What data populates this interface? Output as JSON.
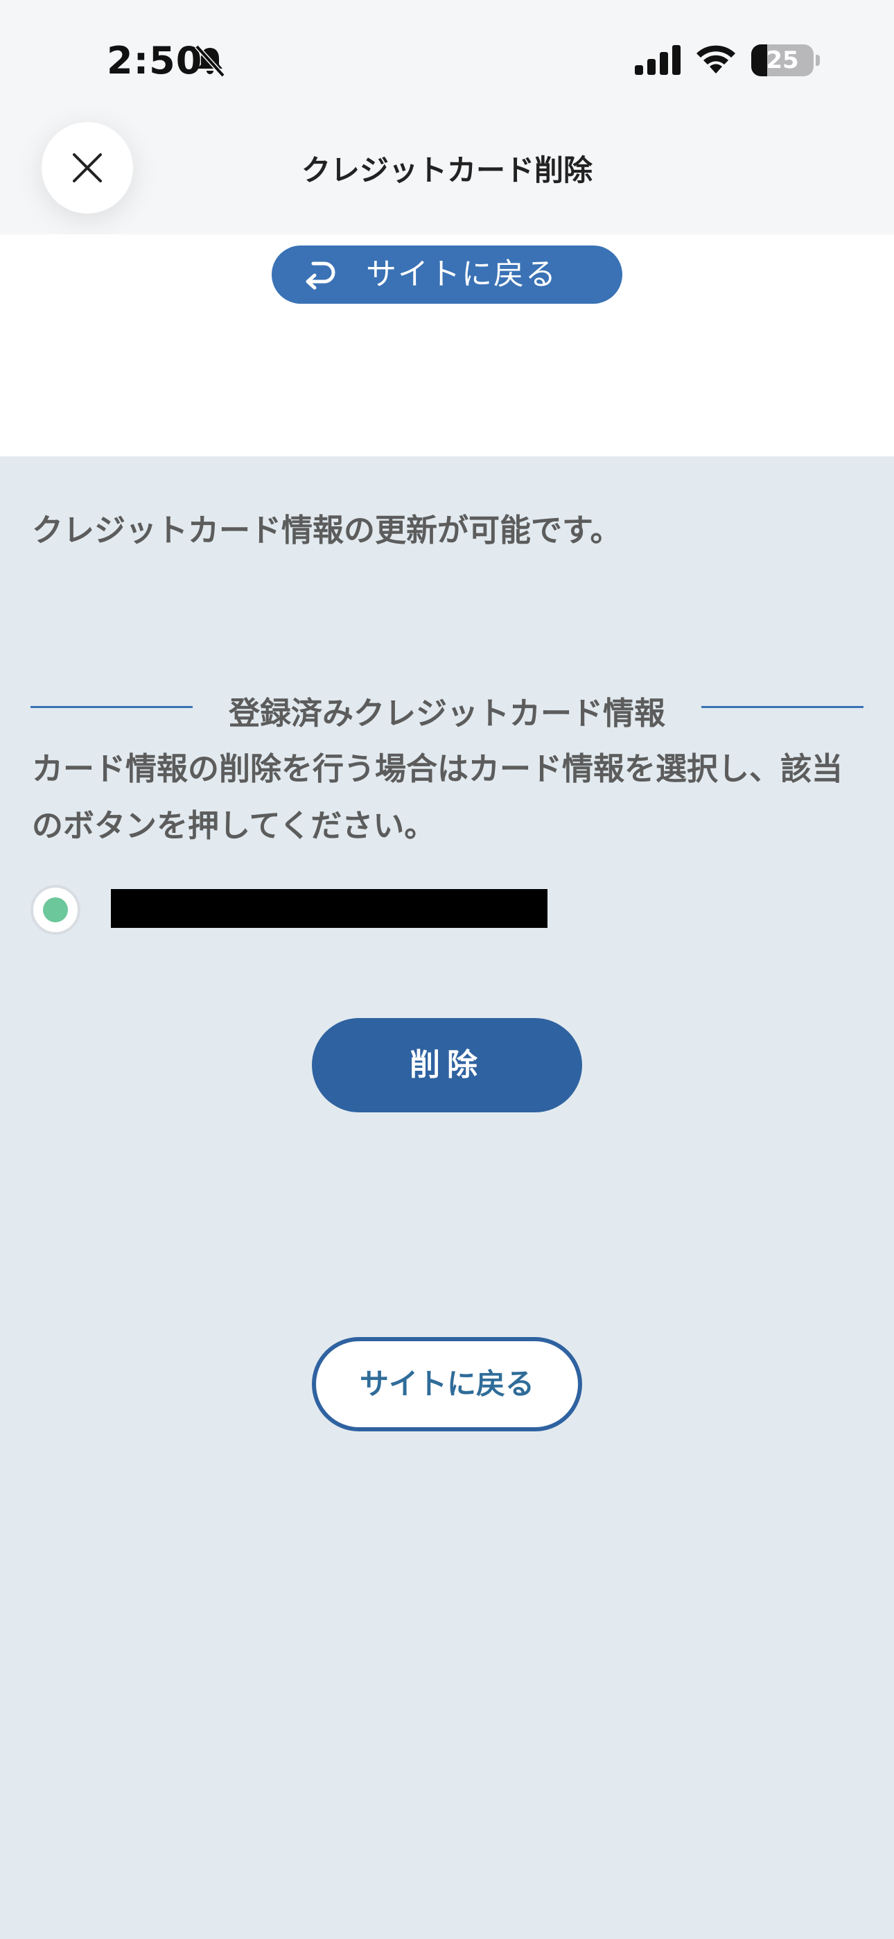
{
  "status_bar": {
    "time": "2:50",
    "battery_level": "25",
    "battery_fraction": 0.25,
    "icons": [
      "bell-slash-icon",
      "cellular-signal-icon",
      "wifi-icon",
      "battery-icon"
    ]
  },
  "nav": {
    "close_icon": "close-icon",
    "title": "クレジットカード削除"
  },
  "top_back_button": {
    "icon": "return-arrow-icon",
    "label": "サイトに戻る"
  },
  "main": {
    "info_text": "クレジットカード情報の更新が可能です。",
    "section_heading": "登録済みクレジットカード情報",
    "instructions": "カード情報の削除を行う場合はカード情報を選択し、該当のボタンを押してください。",
    "card": {
      "selected": true,
      "number_redacted": true
    },
    "delete_button_label": "削除",
    "back_button_label": "サイトに戻る"
  },
  "colors": {
    "primary_blue": "#2f62a0",
    "link_blue": "#3a72b5",
    "radio_selected": "#6cc79b",
    "background": "#e2eaef"
  }
}
